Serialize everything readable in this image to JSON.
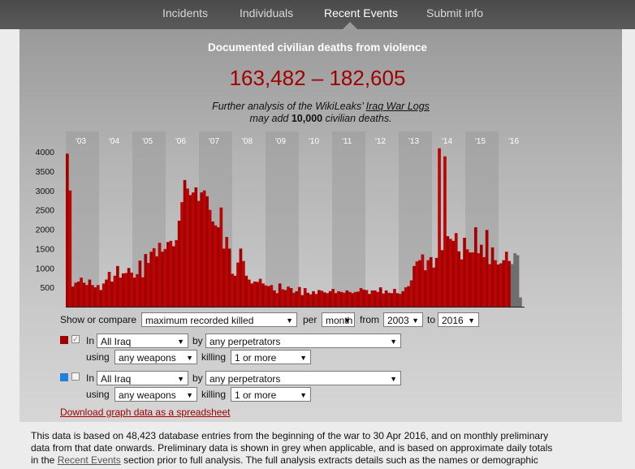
{
  "nav": {
    "tabs": [
      {
        "label": "Incidents"
      },
      {
        "label": "Individuals"
      },
      {
        "label": "Recent Events"
      },
      {
        "label": "Submit info"
      }
    ]
  },
  "header": {
    "title": "Documented civilian deaths from violence",
    "range": "163,482 – 182,605",
    "further_prefix": "Further analysis of the WikiLeaks’ ",
    "further_link": "Iraq War Logs",
    "further_line2_prefix": "may add ",
    "further_bold": "10,000",
    "further_line2_suffix": " civilian deaths."
  },
  "chart_data": {
    "type": "bar",
    "x_unit": "month",
    "year_labels": [
      "'03",
      "'04",
      "'05",
      "'06",
      "'07",
      "'08",
      "'09",
      "'10",
      "'11",
      "'12",
      "'13",
      "'14",
      "'15",
      "'16"
    ],
    "y_ticks": [
      500,
      1000,
      1500,
      2000,
      2500,
      3000,
      3500,
      4000
    ],
    "ylim": [
      0,
      4200
    ],
    "colors": {
      "main": "#a50000",
      "highlight": "#cc1a1a",
      "preliminary": "#6e6e6e"
    },
    "values": [
      3950,
      3000,
      520,
      620,
      650,
      750,
      620,
      560,
      700,
      560,
      500,
      560,
      430,
      600,
      700,
      900,
      650,
      800,
      1050,
      750,
      860,
      870,
      1000,
      880,
      750,
      840,
      1190,
      760,
      1360,
      1130,
      1420,
      1510,
      1300,
      1650,
      1420,
      1490,
      1670,
      1700,
      1560,
      1720,
      2220,
      2700,
      3270,
      3050,
      2880,
      2950,
      3080,
      2730,
      2950,
      3000,
      2850,
      2500,
      2200,
      2100,
      2050,
      2560,
      1500,
      1800,
      1500,
      850,
      800,
      1140,
      1500,
      1180,
      800,
      700,
      600,
      650,
      640,
      720,
      600,
      550,
      530,
      560,
      420,
      350,
      600,
      450,
      430,
      520,
      480,
      360,
      400,
      510,
      300,
      480,
      360,
      320,
      400,
      330,
      430,
      410,
      370,
      350,
      400,
      460,
      350,
      400,
      380,
      360,
      420,
      380,
      350,
      380,
      390,
      480,
      440,
      430,
      330,
      420,
      420,
      380,
      500,
      340,
      420,
      360,
      350,
      460,
      350,
      330,
      400,
      500,
      530,
      680,
      1050,
      1170,
      1200,
      1350,
      940,
      1200,
      1280,
      1010,
      1260,
      4090,
      1460,
      3880,
      1820,
      1750,
      1700,
      1900,
      1430,
      1220,
      1780,
      1480,
      1400,
      1400,
      2050,
      1380,
      1600,
      1280,
      1980,
      1100,
      1530,
      1200,
      1090,
      1120,
      1200,
      1420,
      1180
    ],
    "preliminary": [
      1100,
      1380,
      1330,
      240
    ]
  },
  "controls": {
    "row1": {
      "show_label": "Show or compare",
      "metric": "maximum recorded killed",
      "per_label": "per",
      "period": "month",
      "from_label": "from",
      "from_year": "2003",
      "to_label": "to",
      "to_year": "2016"
    },
    "series1": {
      "color": "#a00000",
      "check_mark": "✓",
      "in_label": "In",
      "region": "All Iraq",
      "by_label": "by",
      "perpetrators": "any perpetrators",
      "using_label": "using",
      "weapons": "any weapons",
      "killing_label": "killing",
      "count": "1 or more"
    },
    "series2": {
      "color": "#1e7fe0",
      "in_label": "In",
      "region": "All Iraq",
      "by_label": "by",
      "perpetrators": "any perpetrators",
      "using_label": "using",
      "weapons": "any weapons",
      "killing_label": "killing",
      "count": "1 or more"
    },
    "download_link": "Download graph data as a spreadsheet"
  },
  "footer": {
    "line1": "This data is based on 48,423 database entries from the beginning of the war to 30 Apr 2016, and on monthly preliminary",
    "line2": "data from that date onwards. Preliminary data is shown in grey when applicable, and is based on approximate daily totals",
    "line3_prefix": "in the ",
    "line3_link": "Recent Events",
    "line3_suffix": " section prior to full analysis. The full analysis extracts details such as the names or demographic"
  }
}
